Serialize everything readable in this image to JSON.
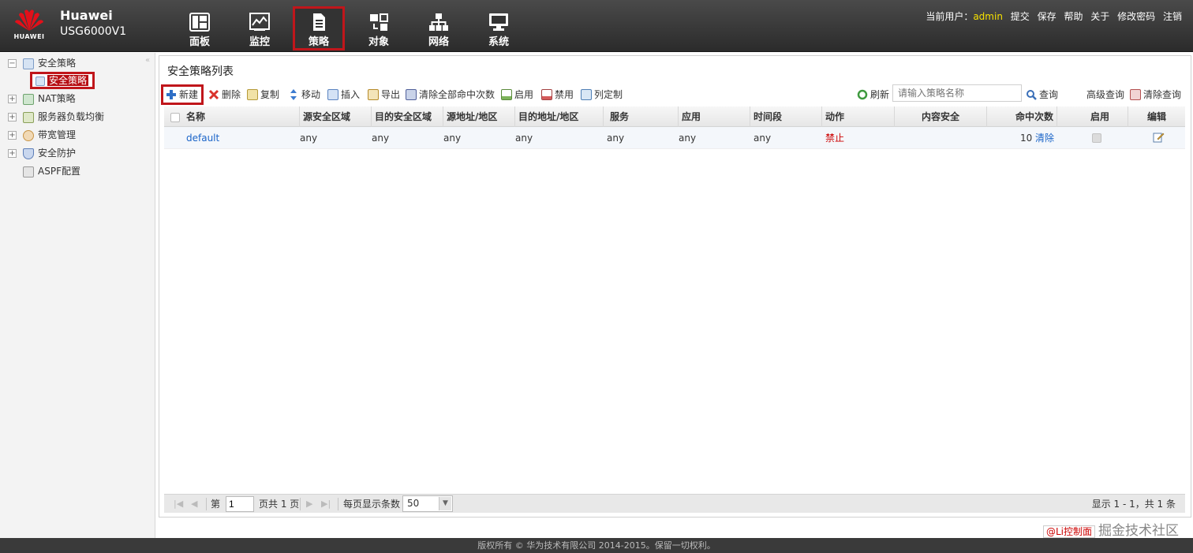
{
  "header": {
    "logo_text": "HUAWEI",
    "brand": "Huawei",
    "model": "USG6000V1",
    "nav": [
      {
        "label": "面板",
        "icon": "dashboard-icon"
      },
      {
        "label": "监控",
        "icon": "monitor-chart-icon"
      },
      {
        "label": "策略",
        "icon": "policy-document-icon"
      },
      {
        "label": "对象",
        "icon": "object-icon"
      },
      {
        "label": "网络",
        "icon": "network-icon"
      },
      {
        "label": "系统",
        "icon": "system-display-icon"
      }
    ],
    "user_label": "当前用户：",
    "user": "admin",
    "links": [
      "提交",
      "保存",
      "帮助",
      "关于",
      "修改密码",
      "注销"
    ]
  },
  "sidebar": {
    "items": [
      {
        "label": "安全策略",
        "expander": "−"
      },
      {
        "label": "安全策略"
      },
      {
        "label": "NAT策略",
        "expander": "+"
      },
      {
        "label": "服务器负载均衡",
        "expander": "+"
      },
      {
        "label": "带宽管理",
        "expander": "+"
      },
      {
        "label": "安全防护",
        "expander": "+"
      },
      {
        "label": "ASPF配置"
      }
    ],
    "collapse": "«"
  },
  "main": {
    "title": "安全策略列表",
    "toolbar": {
      "new": "新建",
      "delete": "删除",
      "copy": "复制",
      "move": "移动",
      "insert": "插入",
      "export": "导出",
      "clear_hits": "清除全部命中次数",
      "enable": "启用",
      "disable": "禁用",
      "columns": "列定制",
      "refresh": "刷新",
      "search_placeholder": "请输入策略名称",
      "query": "查询",
      "advanced_query": "高级查询",
      "clear_query": "清除查询"
    },
    "columns": [
      "名称",
      "源安全区域",
      "目的安全区域",
      "源地址/地区",
      "目的地址/地区",
      "服务",
      "应用",
      "时间段",
      "动作",
      "内容安全",
      "命中次数",
      "启用",
      "编辑"
    ],
    "rows": [
      {
        "name": "default",
        "src_zone": "any",
        "dst_zone": "any",
        "src_addr": "any",
        "dst_addr": "any",
        "service": "any",
        "app": "any",
        "schedule": "any",
        "action": "禁止",
        "content_security": "",
        "hits": "10",
        "clear": "清除"
      }
    ],
    "pager": {
      "page_prefix": "第",
      "page": "1",
      "page_suffix": "页共 1 页",
      "per_page_label": "每页显示条数",
      "per_page": "50",
      "summary": "显示 1 - 1，共 1 条"
    }
  },
  "footer": {
    "copyright": "版权所有 © 华为技术有限公司 2014-2015。保留一切权利。"
  },
  "watermark": {
    "badge": "@Li控制面",
    "text": "掘金技术社区"
  },
  "colors": {
    "highlight": "#c0161b",
    "link": "#1a64c8",
    "deny": "#cc0000",
    "user": "#f6e100"
  }
}
